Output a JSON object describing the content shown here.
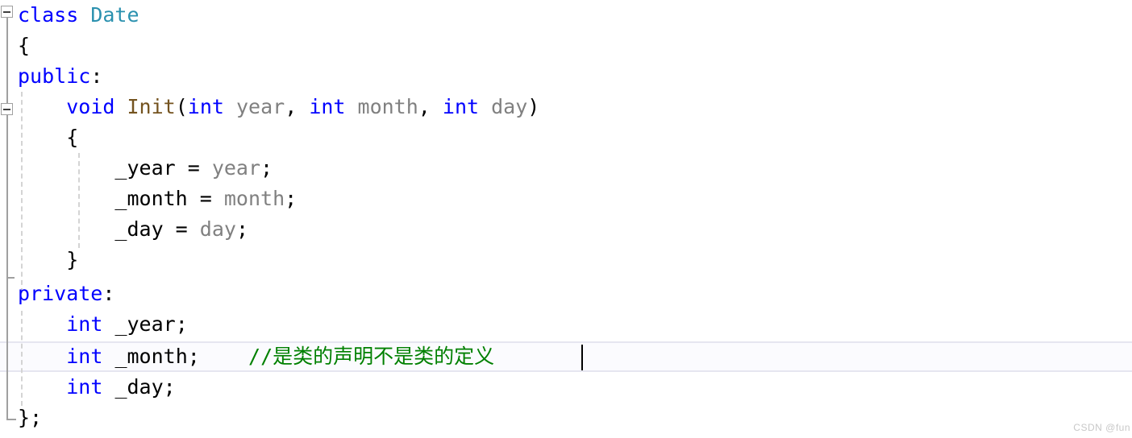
{
  "editor": {
    "language": "cpp",
    "background_color": "#ffffff",
    "current_line_number": 12,
    "colors": {
      "keyword": "#0000ff",
      "type_name": "#2b91af",
      "method_name": "#74531f",
      "parameter": "#808080",
      "identifier": "#000000",
      "comment": "#008000",
      "current_line_border": "#e6e6f0",
      "outline_gray": "#a0a0a0",
      "indent_guide": "#d4d4d4",
      "caret": "#000000",
      "watermark": "#c8c8c8"
    },
    "lines": [
      {
        "number": 1,
        "tokens": [
          {
            "text": "class ",
            "kind": "kw"
          },
          {
            "text": "Date",
            "kind": "type"
          }
        ]
      },
      {
        "number": 2,
        "tokens": [
          {
            "text": "{",
            "kind": "plain"
          }
        ]
      },
      {
        "number": 3,
        "tokens": [
          {
            "text": "public",
            "kind": "kw"
          },
          {
            "text": ":",
            "kind": "plain"
          }
        ]
      },
      {
        "number": 4,
        "tokens": [
          {
            "text": "    ",
            "kind": "plain"
          },
          {
            "text": "void ",
            "kind": "kw"
          },
          {
            "text": "Init",
            "kind": "fn"
          },
          {
            "text": "(",
            "kind": "plain"
          },
          {
            "text": "int ",
            "kind": "kw"
          },
          {
            "text": "year",
            "kind": "param"
          },
          {
            "text": ", ",
            "kind": "plain"
          },
          {
            "text": "int ",
            "kind": "kw"
          },
          {
            "text": "month",
            "kind": "param"
          },
          {
            "text": ", ",
            "kind": "plain"
          },
          {
            "text": "int ",
            "kind": "kw"
          },
          {
            "text": "day",
            "kind": "param"
          },
          {
            "text": ")",
            "kind": "plain"
          }
        ]
      },
      {
        "number": 5,
        "tokens": [
          {
            "text": "    {",
            "kind": "plain"
          }
        ]
      },
      {
        "number": 6,
        "tokens": [
          {
            "text": "        _year = ",
            "kind": "plain"
          },
          {
            "text": "year",
            "kind": "param"
          },
          {
            "text": ";",
            "kind": "plain"
          }
        ]
      },
      {
        "number": 7,
        "tokens": [
          {
            "text": "        _month = ",
            "kind": "plain"
          },
          {
            "text": "month",
            "kind": "param"
          },
          {
            "text": ";",
            "kind": "plain"
          }
        ]
      },
      {
        "number": 8,
        "tokens": [
          {
            "text": "        _day = ",
            "kind": "plain"
          },
          {
            "text": "day",
            "kind": "param"
          },
          {
            "text": ";",
            "kind": "plain"
          }
        ]
      },
      {
        "number": 9,
        "tokens": [
          {
            "text": "    }",
            "kind": "plain"
          }
        ]
      },
      {
        "number": 10,
        "tokens": [
          {
            "text": "private",
            "kind": "kw"
          },
          {
            "text": ":",
            "kind": "plain"
          }
        ]
      },
      {
        "number": 11,
        "tokens": [
          {
            "text": "    ",
            "kind": "plain"
          },
          {
            "text": "int ",
            "kind": "kw"
          },
          {
            "text": "_year;",
            "kind": "plain"
          }
        ]
      },
      {
        "number": 12,
        "tokens": [
          {
            "text": "    ",
            "kind": "plain"
          },
          {
            "text": "int ",
            "kind": "kw"
          },
          {
            "text": "_month;",
            "kind": "plain"
          },
          {
            "text": "    ",
            "kind": "plain"
          },
          {
            "text": "//是类的声明不是类的定义",
            "kind": "cmt"
          }
        ]
      },
      {
        "number": 13,
        "tokens": [
          {
            "text": "    ",
            "kind": "plain"
          },
          {
            "text": "int ",
            "kind": "kw"
          },
          {
            "text": "_day;",
            "kind": "plain"
          }
        ]
      },
      {
        "number": 14,
        "tokens": [
          {
            "text": "};",
            "kind": "plain"
          }
        ]
      }
    ],
    "outlining": [
      {
        "name": "class-date-region",
        "line": 1,
        "state": "expanded",
        "glyph": "minus"
      },
      {
        "name": "method-init-region",
        "line": 4,
        "state": "expanded",
        "glyph": "minus"
      }
    ]
  },
  "watermark": {
    "text": "CSDN @fun"
  }
}
